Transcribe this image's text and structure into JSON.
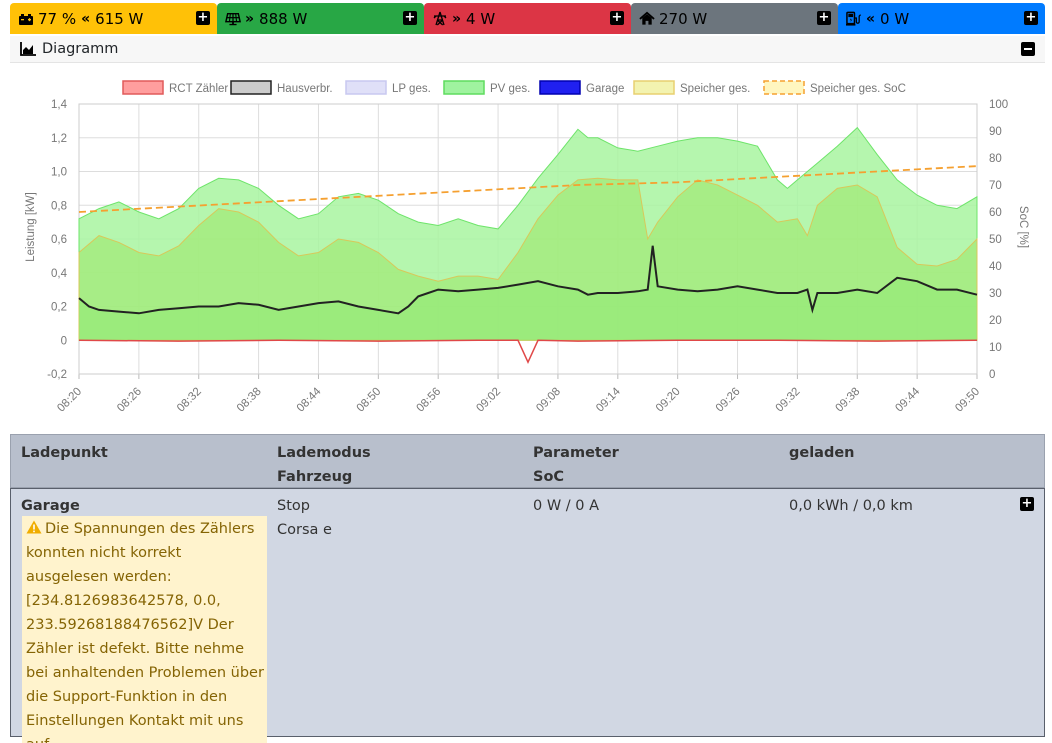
{
  "statusbar": {
    "battery": {
      "percent": "77 %",
      "arrow": "«",
      "power": "615 W",
      "color": "#ffc107",
      "icon": "car-battery-icon"
    },
    "pv": {
      "arrow": "»",
      "power": "888 W",
      "color": "#28a745",
      "icon": "solar-panel-icon"
    },
    "grid": {
      "arrow": "»",
      "power": "4 W",
      "color": "#dc3545",
      "icon": "power-tower-icon"
    },
    "house": {
      "power": "270 W",
      "color": "#6c757d",
      "icon": "home-icon"
    },
    "chargepoint": {
      "arrow": "«",
      "power": "0 W",
      "color": "#007bff",
      "icon": "charging-station-icon"
    }
  },
  "diagram": {
    "title": "Diagramm",
    "collapse_icon": "minus-square-icon"
  },
  "chart_data": {
    "type": "area",
    "legend": [
      {
        "name": "RCT Zähler",
        "color": "#ff9e9e",
        "stroke": "#e05a5a"
      },
      {
        "name": "Hausverbr.",
        "color": "#cccccc",
        "stroke": "#222222"
      },
      {
        "name": "LP ges.",
        "color": "#e0e0f8",
        "stroke": "#c8c8f0"
      },
      {
        "name": "PV ges.",
        "color": "#9ff39f",
        "stroke": "#5fdc5f"
      },
      {
        "name": "Garage",
        "color": "#2020f0",
        "stroke": "#0000b0"
      },
      {
        "name": "Speicher ges.",
        "color": "#f3f3b0",
        "stroke": "#e8d070"
      },
      {
        "name": "Speicher ges. SoC",
        "color": "#fff6c0",
        "stroke": "#f5a030",
        "dashed": true
      }
    ],
    "ylabel": "Leistung [kW]",
    "ylabel_right": "SoC [%]",
    "y_ticks": [
      "1,4",
      "1,2",
      "1,0",
      "0,8",
      "0,6",
      "0,4",
      "0,2",
      "0",
      "-0,2"
    ],
    "y_right_ticks": [
      "100",
      "90",
      "80",
      "70",
      "60",
      "50",
      "40",
      "30",
      "20",
      "10",
      "0"
    ],
    "ylim": [
      -0.2,
      1.4
    ],
    "ylim_right": [
      0,
      100
    ],
    "x_ticks": [
      "08:20",
      "08:26",
      "08:32",
      "08:38",
      "08:44",
      "08:50",
      "08:56",
      "09:02",
      "09:08",
      "09:14",
      "09:20",
      "09:26",
      "09:32",
      "09:38",
      "09:44",
      "09:50"
    ],
    "x_minutes": [
      0,
      90
    ],
    "series": [
      {
        "name": "PV ges.",
        "x": [
          0,
          2,
          4,
          6,
          8,
          10,
          12,
          14,
          16,
          18,
          20,
          22,
          24,
          26,
          28,
          30,
          32,
          34,
          36,
          38,
          40,
          42,
          44,
          46,
          48,
          50,
          51,
          52,
          54,
          56,
          58,
          60,
          62,
          64,
          66,
          68,
          69,
          70,
          71,
          72,
          74,
          76,
          78,
          80,
          82,
          84,
          86,
          88,
          90
        ],
        "y": [
          0.72,
          0.78,
          0.82,
          0.76,
          0.72,
          0.78,
          0.9,
          0.96,
          0.95,
          0.9,
          0.8,
          0.72,
          0.75,
          0.85,
          0.87,
          0.83,
          0.75,
          0.7,
          0.68,
          0.72,
          0.68,
          0.66,
          0.8,
          0.96,
          1.1,
          1.25,
          1.2,
          1.2,
          1.14,
          1.12,
          1.15,
          1.18,
          1.2,
          1.2,
          1.18,
          1.15,
          1.05,
          0.95,
          0.9,
          0.95,
          1.05,
          1.15,
          1.26,
          1.1,
          0.95,
          0.86,
          0.8,
          0.78,
          0.85
        ]
      },
      {
        "name": "Speicher ges.",
        "x": [
          0,
          2,
          4,
          6,
          8,
          10,
          12,
          14,
          16,
          18,
          20,
          22,
          24,
          26,
          28,
          30,
          32,
          34,
          36,
          38,
          40,
          42,
          44,
          46,
          48,
          50,
          52,
          54,
          56,
          57,
          58,
          60,
          62,
          64,
          66,
          68,
          70,
          72,
          73,
          74,
          76,
          78,
          80,
          82,
          84,
          86,
          88,
          90
        ],
        "y": [
          0.52,
          0.62,
          0.58,
          0.52,
          0.5,
          0.56,
          0.68,
          0.78,
          0.76,
          0.7,
          0.58,
          0.5,
          0.52,
          0.6,
          0.58,
          0.52,
          0.42,
          0.38,
          0.35,
          0.38,
          0.38,
          0.36,
          0.52,
          0.72,
          0.86,
          0.95,
          0.96,
          0.95,
          0.95,
          0.6,
          0.7,
          0.85,
          0.95,
          0.92,
          0.86,
          0.8,
          0.7,
          0.72,
          0.62,
          0.8,
          0.9,
          0.92,
          0.85,
          0.55,
          0.45,
          0.44,
          0.48,
          0.6
        ]
      },
      {
        "name": "Hausverbr.",
        "x": [
          0,
          1,
          2,
          4,
          6,
          8,
          10,
          12,
          14,
          16,
          18,
          20,
          22,
          24,
          26,
          28,
          30,
          32,
          33,
          34,
          35,
          36,
          38,
          40,
          42,
          44,
          46,
          48,
          50,
          51,
          52,
          54,
          56,
          57,
          57.5,
          58,
          60,
          62,
          64,
          66,
          68,
          70,
          72,
          73,
          73.5,
          74,
          76,
          78,
          80,
          82,
          84,
          86,
          88,
          90
        ],
        "y": [
          0.25,
          0.2,
          0.18,
          0.17,
          0.16,
          0.18,
          0.19,
          0.2,
          0.2,
          0.22,
          0.21,
          0.18,
          0.2,
          0.22,
          0.23,
          0.2,
          0.18,
          0.16,
          0.2,
          0.26,
          0.28,
          0.3,
          0.29,
          0.3,
          0.31,
          0.33,
          0.35,
          0.32,
          0.3,
          0.27,
          0.28,
          0.28,
          0.29,
          0.3,
          0.56,
          0.32,
          0.3,
          0.29,
          0.3,
          0.32,
          0.3,
          0.28,
          0.28,
          0.3,
          0.18,
          0.28,
          0.28,
          0.3,
          0.28,
          0.37,
          0.35,
          0.3,
          0.3,
          0.27
        ]
      },
      {
        "name": "RCT Zähler",
        "x": [
          0,
          10,
          20,
          30,
          40,
          44,
          45,
          46,
          50,
          60,
          70,
          80,
          90
        ],
        "y": [
          0.0,
          -0.005,
          0.0,
          -0.005,
          0.0,
          0.0,
          -0.13,
          0.0,
          -0.005,
          0.0,
          0.0,
          -0.005,
          0.0
        ]
      },
      {
        "name": "Speicher ges. SoC",
        "x": [
          0,
          10,
          20,
          30,
          40,
          50,
          60,
          70,
          80,
          90
        ],
        "y": [
          60,
          62,
          64,
          66,
          68,
          70,
          71,
          73,
          75,
          77
        ],
        "axis": "right"
      }
    ]
  },
  "table": {
    "header": {
      "ladepunkt": "Ladepunkt",
      "lademodus": "Lademodus",
      "fahrzeug": "Fahrzeug",
      "parameter": "Parameter",
      "soc": "SoC",
      "geladen": "geladen"
    },
    "rows": [
      {
        "name": "Garage",
        "mode": "Stop",
        "vehicle": "Corsa e",
        "parameter": "0 W / 0 A",
        "charged": "0,0 kWh / 0,0 km",
        "warning": "Die Spannungen des Zählers konnten nicht korrekt ausgelesen werden: [234.8126983642578, 0.0, 233.59268188476562]V Der Zähler ist defekt. Bitte nehme bei anhaltenden Problemen über die Support-Funktion in den Einstellungen Kontakt mit uns auf."
      }
    ]
  }
}
